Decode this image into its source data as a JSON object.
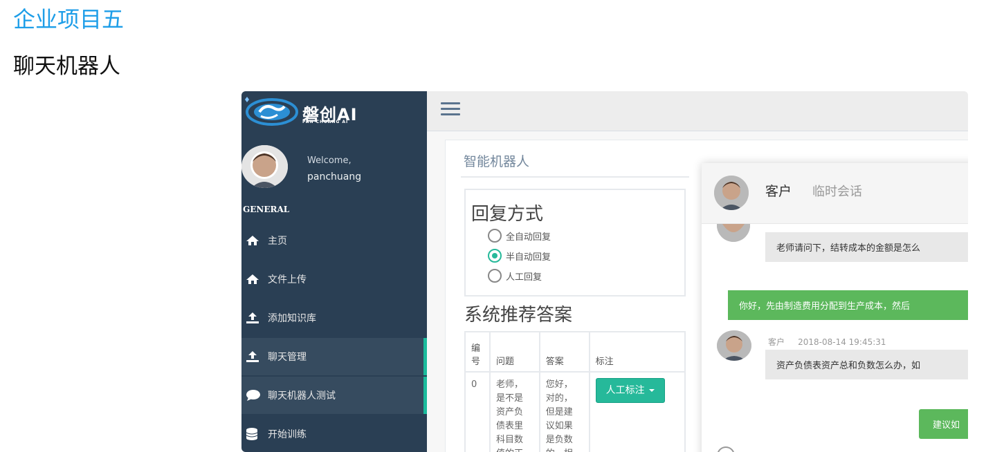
{
  "page": {
    "heading": "企业项目五",
    "subheading": "聊天机器人"
  },
  "sidebar": {
    "brand_title": "磐创AI",
    "brand_subtitle": "PAN CHUANG AI",
    "welcome_label": "Welcome,",
    "username": "panchuang",
    "section_label": "GENERAL",
    "items": [
      {
        "label": "主页",
        "icon": "home-icon",
        "active": false
      },
      {
        "label": "文件上传",
        "icon": "home-icon",
        "active": false
      },
      {
        "label": "添加知识库",
        "icon": "upload-icon",
        "active": false
      },
      {
        "label": "聊天管理",
        "icon": "upload-icon",
        "active": true
      },
      {
        "label": "聊天机器人测试",
        "icon": "chat-bubble-icon",
        "active": true
      },
      {
        "label": "开始训练",
        "icon": "database-icon",
        "active": false
      }
    ]
  },
  "main": {
    "panel_title": "智能机器人",
    "reply_mode": {
      "title": "回复方式",
      "options": [
        {
          "label": "全自动回复",
          "checked": false
        },
        {
          "label": "半自动回复",
          "checked": true
        },
        {
          "label": "人工回复",
          "checked": false
        }
      ]
    },
    "recommend": {
      "title": "系统推荐答案",
      "headers": [
        "编号",
        "问题",
        "答案",
        "标注"
      ],
      "rows": [
        {
          "num": "0",
          "question": "老师，是不是资产负债表里科目数值的正",
          "answer": "您好，对的，但是建议如果是负数的，相",
          "tag_button": "人工标注"
        }
      ]
    }
  },
  "chat": {
    "contact_name": "客户",
    "session_type": "临时会话",
    "messages": [
      {
        "side": "left",
        "text": "老师请问下，结转成本的金额是怎么"
      },
      {
        "side": "right",
        "text": "你好，先由制造费用分配到生产成本，然后"
      },
      {
        "side": "left",
        "sender": "客户",
        "time": "2018-08-14 19:45:31",
        "text": "资产负债表资产总和负数怎么办，如"
      }
    ],
    "suggest_button": "建议如"
  },
  "colors": {
    "sidebar_bg": "#2a3f54",
    "accent_green": "#26b99a",
    "bubble_green": "#5cb85c",
    "heading_blue": "#1e9ee8"
  }
}
